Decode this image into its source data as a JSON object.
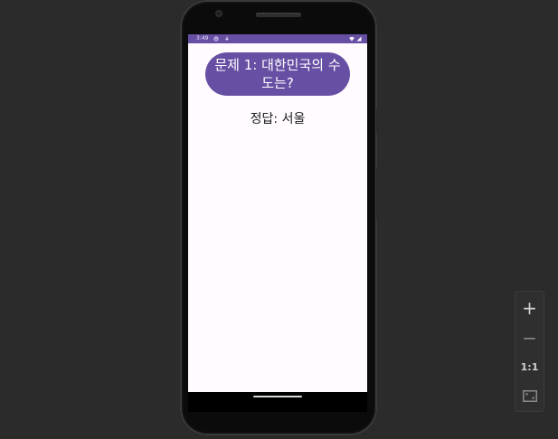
{
  "status_bar": {
    "time": "3:49",
    "icons": [
      "settings-icon",
      "download-icon",
      "wifi-icon",
      "signal-icon"
    ],
    "color": "#6750a4"
  },
  "app": {
    "question_button_label": "문제 1: 대한민국의 수도는?",
    "answer_text": "정답: 서울",
    "accent_color": "#6750a4"
  },
  "zoom_controls": {
    "zoom_in_label": "+",
    "zoom_out_label": "−",
    "reset_label": "1:1",
    "fit_icon": "fit-screen-icon"
  }
}
